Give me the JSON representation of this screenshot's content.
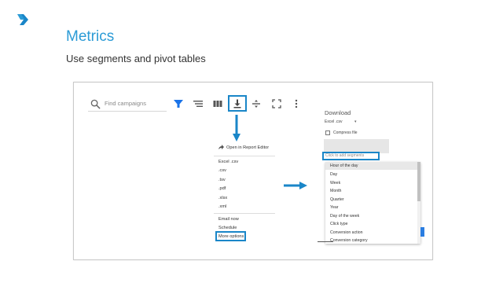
{
  "slide": {
    "title": "Metrics",
    "subtitle": "Use segments and pivot tables"
  },
  "toolbar": {
    "search_placeholder": "Find campaigns"
  },
  "export_menu": {
    "open_in_editor": "Open in Report Editor",
    "formats": [
      "Excel .csv",
      ".csv",
      ".tsv",
      ".pdf",
      ".xlsx",
      ".xml"
    ],
    "email_now": "Email now",
    "schedule": "Schedule",
    "more_options": "More options"
  },
  "download_panel": {
    "title": "Download",
    "format_value": "Excel .csv",
    "compress_label": "Compress file",
    "segments_placeholder": "Click to add segments",
    "segments": [
      "Hour of the day",
      "Day",
      "Week",
      "Month",
      "Quarter",
      "Year",
      "Day of the week",
      "Click type",
      "Conversion action",
      "Conversion category"
    ]
  },
  "colors": {
    "accent": "#2b9bd6",
    "highlight_border": "#1a86c8",
    "filter_icon": "#1a73e8"
  },
  "icons": [
    "logo-icon",
    "search-icon",
    "filter-icon",
    "segment-icon",
    "columns-icon",
    "download-icon",
    "compare-icon",
    "fullscreen-icon",
    "more-icon",
    "open-external-icon",
    "down-arrow-icon",
    "right-arrow-icon"
  ]
}
